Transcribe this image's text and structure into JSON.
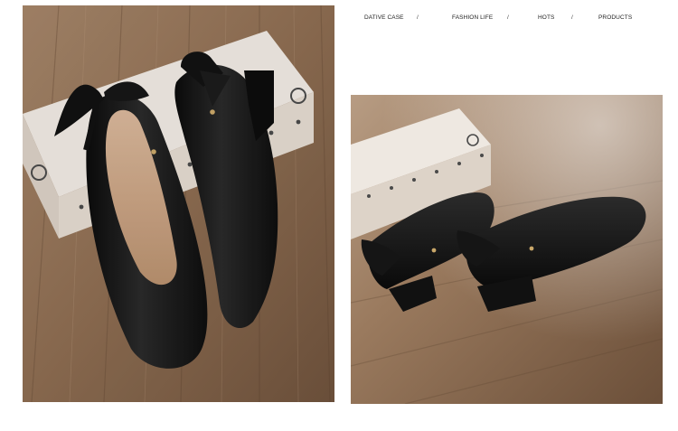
{
  "nav": {
    "items": [
      {
        "label": "DATIVE CASE"
      },
      {
        "label": "FASHION LIFE"
      },
      {
        "label": "HOTS"
      },
      {
        "label": "PRODUCTS"
      }
    ],
    "separator": "/"
  },
  "photos": {
    "left": {
      "subject": "black leather bow pumps on shoebox, top view"
    },
    "right": {
      "subject": "black leather bow pumps on shoebox, rear view"
    }
  },
  "colors": {
    "background": "#ffffff",
    "wood": "#8a6a4e",
    "leather": "#141414",
    "box": "#e9e2da"
  }
}
